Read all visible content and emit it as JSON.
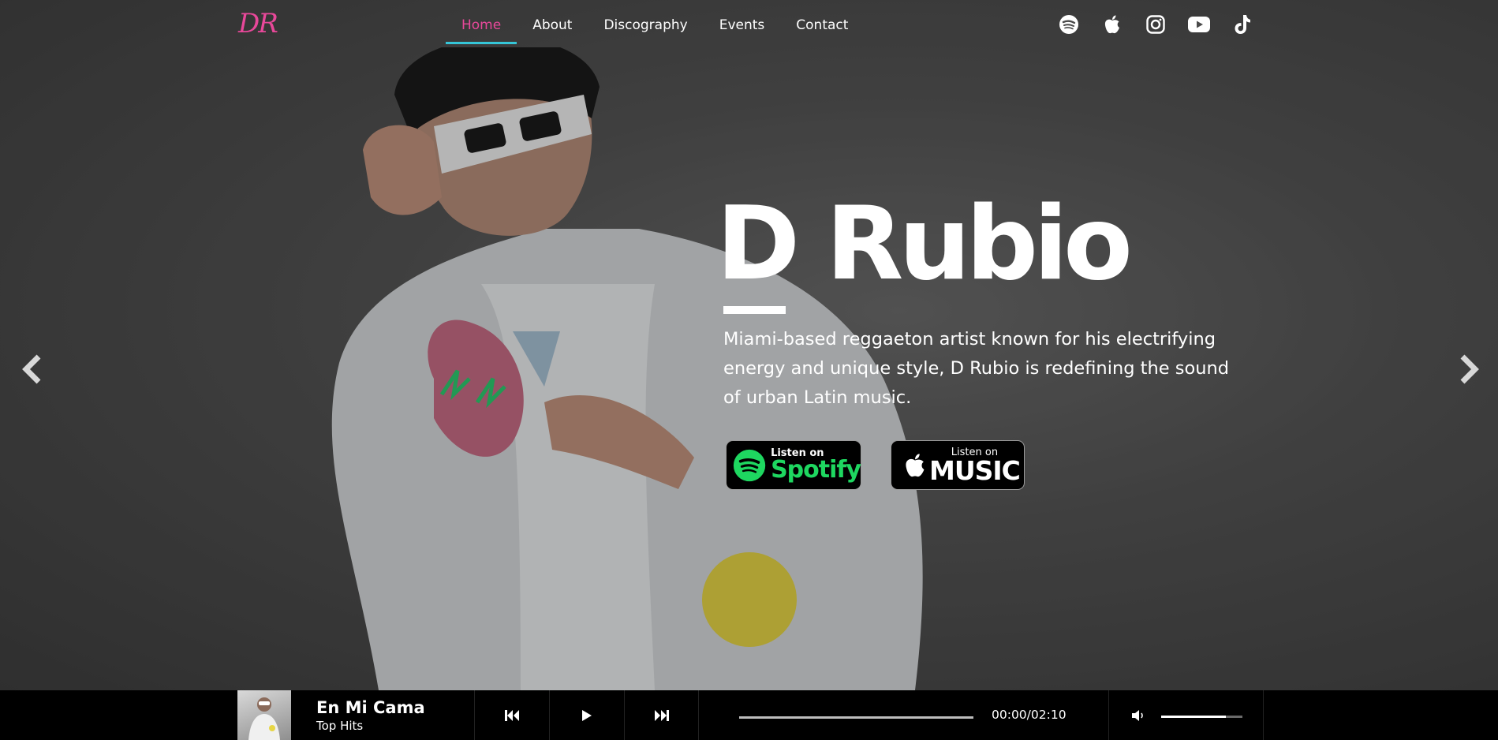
{
  "brand": {
    "logo_text": "DR",
    "accent": "#e8489a",
    "underline": "#35c6d8"
  },
  "nav": {
    "items": [
      {
        "label": "Home",
        "active": true
      },
      {
        "label": "About",
        "active": false
      },
      {
        "label": "Discography",
        "active": false
      },
      {
        "label": "Events",
        "active": false
      },
      {
        "label": "Contact",
        "active": false
      }
    ],
    "social_icons": [
      "spotify-icon",
      "apple-icon",
      "instagram-icon",
      "youtube-icon",
      "tiktok-icon"
    ]
  },
  "hero": {
    "title": "D Rubio",
    "description": "Miami-based reggaeton artist known for his electrifying energy and unique style, D Rubio is redefining the sound of urban Latin music.",
    "spotify_badge": {
      "small": "Listen on",
      "big": "Spotify",
      "color": "#1ed760"
    },
    "apple_badge": {
      "small": "Listen on",
      "big": "MUSIC"
    },
    "carousel_icons": [
      "chevron-left-icon",
      "chevron-right-icon"
    ]
  },
  "player": {
    "track_title": "En Mi Cama",
    "track_subtitle": "Top Hits",
    "time": "00:00/02:10",
    "progress": 0,
    "volume": 0.8,
    "controls": [
      "previous-icon",
      "play-icon",
      "next-icon"
    ]
  }
}
